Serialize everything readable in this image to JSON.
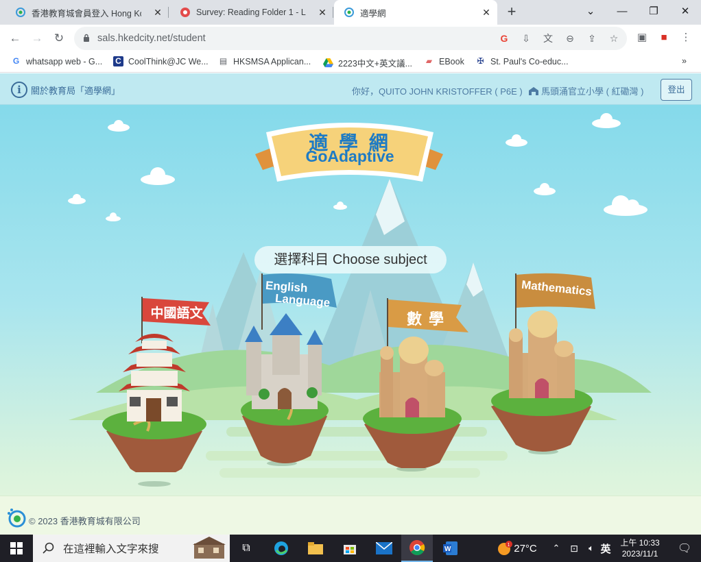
{
  "browser": {
    "tabs": [
      {
        "title": "香港教育城會員登入 Hong Kong"
      },
      {
        "title": "Survey: Reading Folder 1 - Lea"
      },
      {
        "title": "適學網"
      }
    ],
    "url": "sals.hkedcity.net/student",
    "bookmarks": [
      {
        "label": "whatsapp web - G..."
      },
      {
        "label": "CoolThink@JC We..."
      },
      {
        "label": "HKSMSA Applican..."
      },
      {
        "label": "2223中文+英文議..."
      },
      {
        "label": "EBook"
      },
      {
        "label": "St. Paul's Co-educ..."
      }
    ],
    "bookmarks_more": "»"
  },
  "site": {
    "about": "關於教育局「適學網」",
    "greeting": "你好，QUITO JOHN KRISTOFFER ( P6E )",
    "school": "馬頭涌官立小學 ( 紅磡灣 )",
    "logout": "登出",
    "logo_cn": "適 學 網",
    "logo_en": "GoAdaptive",
    "choose": "選擇科目 Choose subject",
    "subjects": [
      {
        "label": "中國語文"
      },
      {
        "label_line1": "English",
        "label_line2": "Language"
      },
      {
        "label": "數 學"
      },
      {
        "label": "Mathematics"
      }
    ],
    "copyright": "© 2023 香港教育城有限公司"
  },
  "taskbar": {
    "search_placeholder": "在這裡輸入文字來搜",
    "weather": "27°C",
    "weather_badge": "1",
    "ime": "英",
    "time": "上午 10:33",
    "date": "2023/11/1"
  },
  "colors": {
    "brand": "#3a6c99",
    "chinese_flag": "#d9473c",
    "english_flag": "#4a9ac4",
    "math_cn_flag": "#d99b45",
    "math_en_flag": "#c98d3f"
  }
}
